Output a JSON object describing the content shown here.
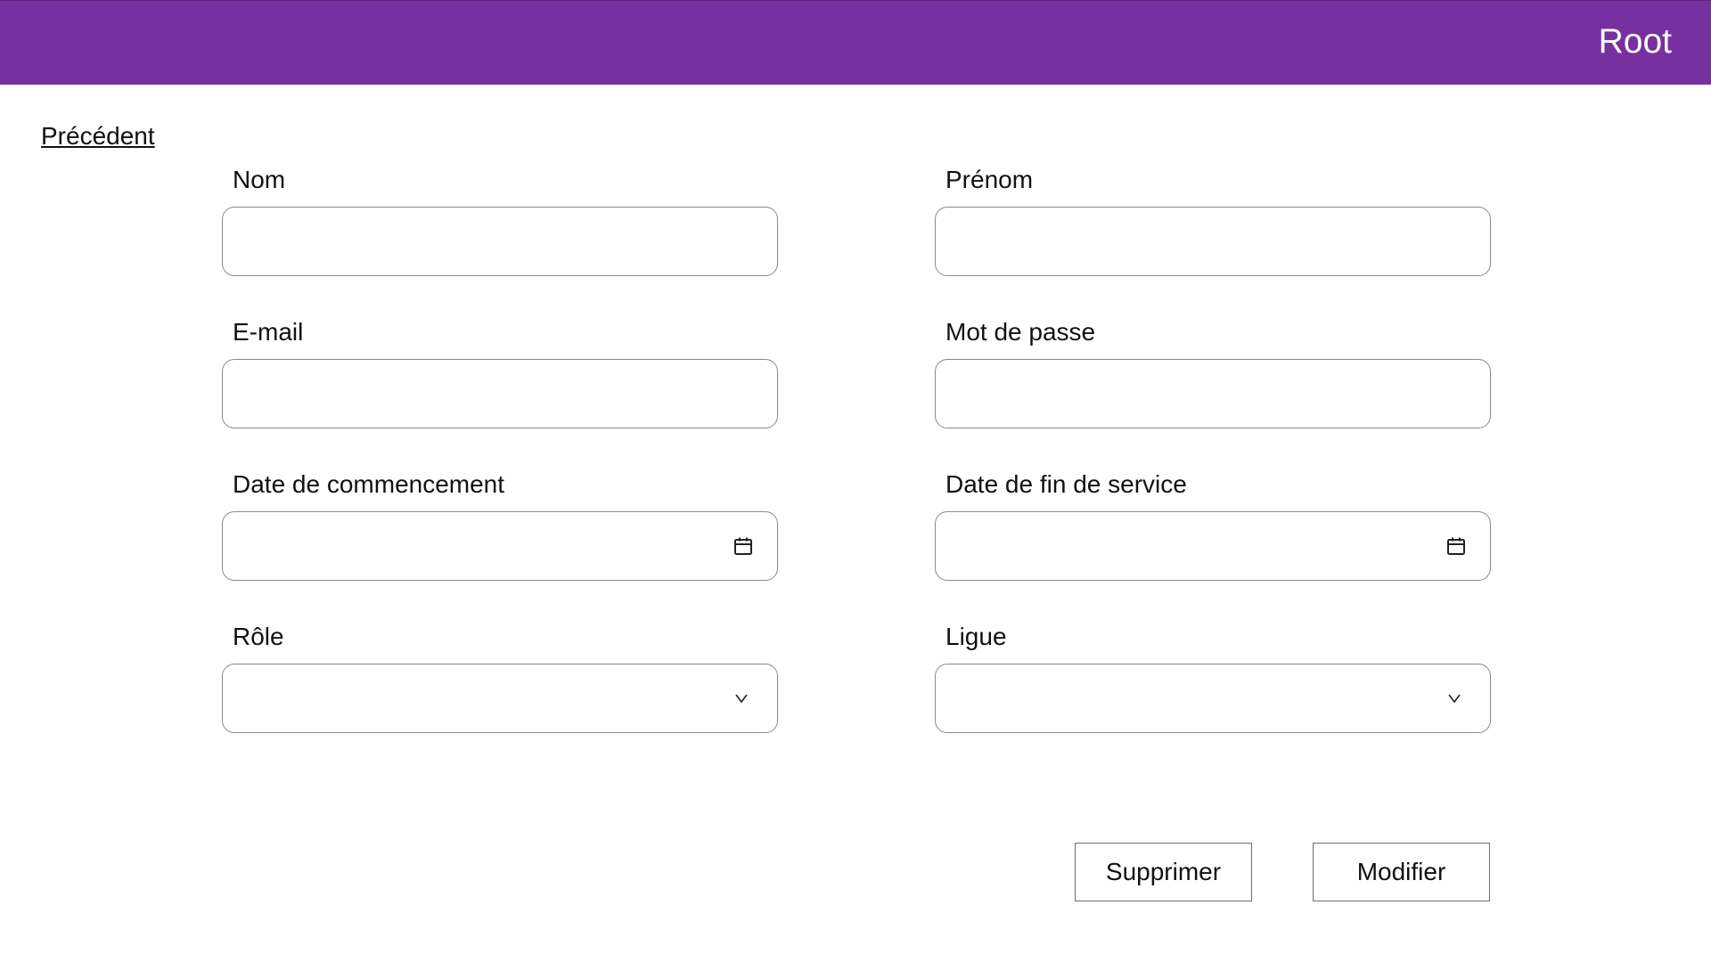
{
  "header": {
    "title": "Root",
    "background": "#7730a0"
  },
  "nav": {
    "back_label": "Précédent"
  },
  "form": {
    "nom": {
      "label": "Nom",
      "value": ""
    },
    "prenom": {
      "label": "Prénom",
      "value": ""
    },
    "email": {
      "label": "E-mail",
      "value": ""
    },
    "password": {
      "label": "Mot de passe",
      "value": ""
    },
    "start_date": {
      "label": "Date de commencement",
      "value": "",
      "icon": "calendar-icon"
    },
    "end_date": {
      "label": "Date de fin de service",
      "value": "",
      "icon": "calendar-icon"
    },
    "role": {
      "label": "Rôle",
      "selected": "",
      "icon": "chevron-down-icon"
    },
    "ligue": {
      "label": "Ligue",
      "selected": "",
      "icon": "chevron-down-icon"
    }
  },
  "actions": {
    "delete_label": "Supprimer",
    "edit_label": "Modifier"
  }
}
